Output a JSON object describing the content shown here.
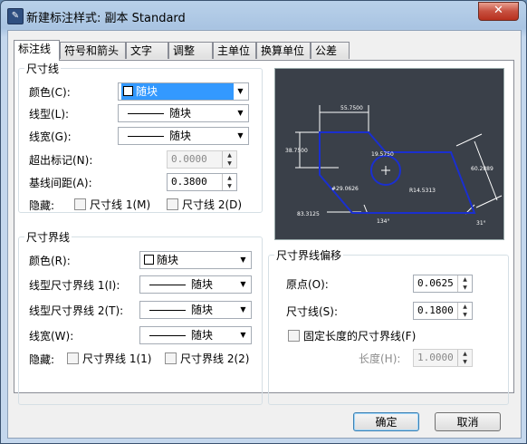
{
  "window": {
    "title": "新建标注样式: 副本 Standard",
    "close_label": "✕"
  },
  "tabs": [
    {
      "label": "标注线"
    },
    {
      "label": "符号和箭头"
    },
    {
      "label": "文字"
    },
    {
      "label": "调整"
    },
    {
      "label": "主单位"
    },
    {
      "label": "换算单位"
    },
    {
      "label": "公差"
    }
  ],
  "dim_line": {
    "legend": "尺寸线",
    "color_label": "颜色(C):",
    "color_value": "随块",
    "linetype_label": "线型(L):",
    "linetype_value": "随块",
    "lineweight_label": "线宽(G):",
    "lineweight_value": "随块",
    "extend_label": "超出标记(N):",
    "extend_value": "0.0000",
    "baseline_label": "基线间距(A):",
    "baseline_value": "0.3800",
    "suppress_label": "隐藏:",
    "suppress1": "尺寸线 1(M)",
    "suppress2": "尺寸线 2(D)"
  },
  "ext_line": {
    "legend": "尺寸界线",
    "color_label": "颜色(R):",
    "color_value": "随块",
    "lt1_label": "线型尺寸界线 1(I):",
    "lt1_value": "随块",
    "lt2_label": "线型尺寸界线 2(T):",
    "lt2_value": "随块",
    "lineweight_label": "线宽(W):",
    "lineweight_value": "随块",
    "suppress_label": "隐藏:",
    "suppress1": "尺寸界线 1(1)",
    "suppress2": "尺寸界线 2(2)"
  },
  "offset": {
    "legend": "尺寸界线偏移",
    "origin_label": "原点(O):",
    "origin_value": "0.0625",
    "dimline_label": "尺寸线(S):",
    "dimline_value": "0.1800",
    "fixed_label": "固定长度的尺寸界线(F)",
    "length_label": "长度(H):",
    "length_value": "1.0000"
  },
  "preview": {
    "d1": "55.7500",
    "d2": "38.7500",
    "d3": "19.5750",
    "d4": "60.2889",
    "d5": "R14.5313",
    "d6": "#29.0626",
    "d7": "83.3125",
    "d8": "134°",
    "d9": "31°"
  },
  "buttons": {
    "ok": "确定",
    "cancel": "取消"
  }
}
